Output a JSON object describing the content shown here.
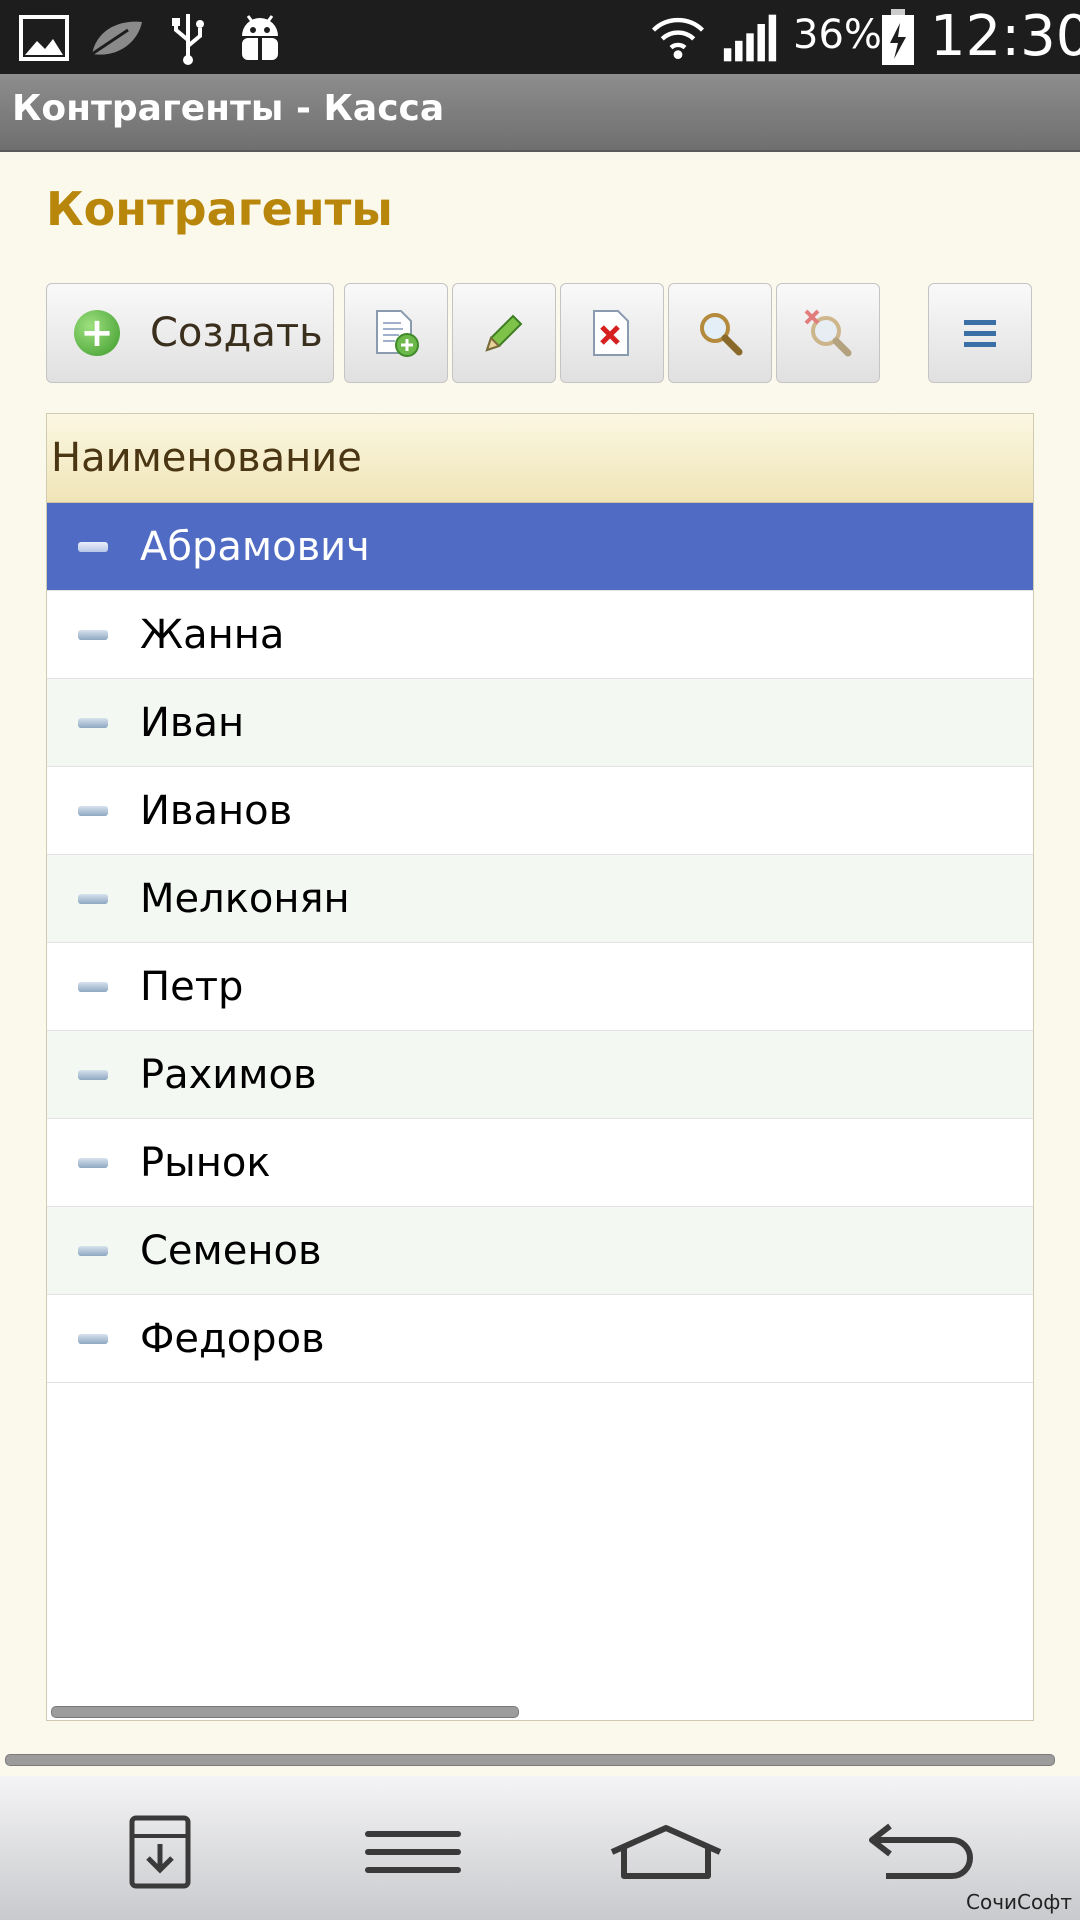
{
  "status_bar": {
    "battery_percent": "36%",
    "time": "12:30",
    "icons": [
      "gallery-icon",
      "leaf-icon",
      "usb-icon",
      "debug-android-icon",
      "wifi-icon",
      "signal-icon",
      "battery-charging-icon"
    ]
  },
  "window": {
    "title": "Контрагенты - Касса"
  },
  "page": {
    "title": "Контрагенты"
  },
  "toolbar": {
    "create_label": "Создать",
    "buttons": [
      "add-copy-icon",
      "edit-pencil-icon",
      "delete-icon",
      "search-icon",
      "cancel-search-icon",
      "menu-icon"
    ]
  },
  "table": {
    "column_header": "Наименование",
    "selected_index": 0,
    "rows": [
      "Абрамович",
      "Жанна",
      "Иван",
      "Иванов",
      "Мелконян",
      "Петр",
      "Рахимов",
      "Рынок",
      "Семенов",
      "Федоров"
    ]
  },
  "nav": {
    "buttons": [
      "download-icon",
      "menu-lines-icon",
      "home-icon",
      "back-icon"
    ]
  },
  "watermark": "СочиСофт",
  "colors": {
    "accent": "#b8860b",
    "selection": "#506bc3"
  }
}
